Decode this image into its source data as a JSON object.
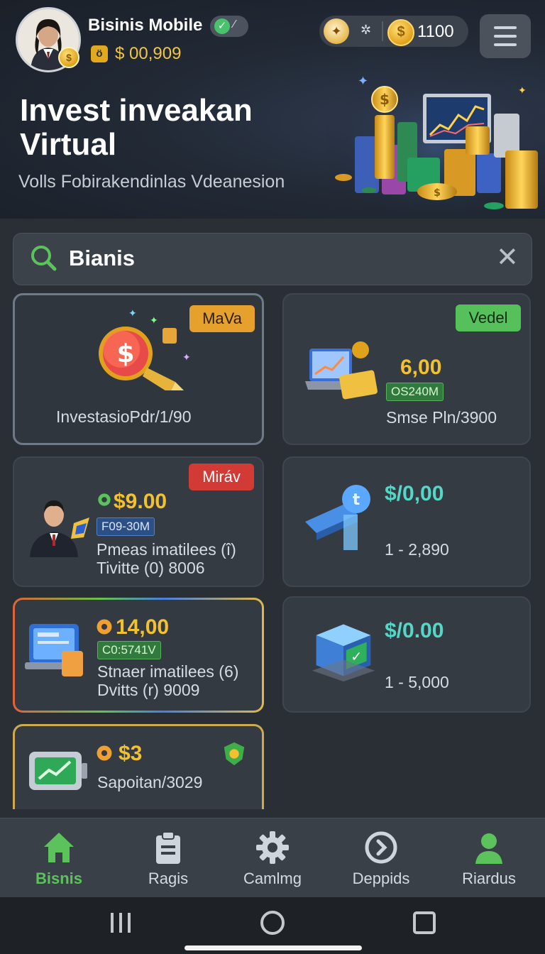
{
  "header": {
    "username": "Bisinis Mobile",
    "balance": "$ 00,909",
    "coins": "1100"
  },
  "hero": {
    "title": "Invest inveakan Virtual",
    "subtitle": "Volls Fobirakendinlas Vdeanesion"
  },
  "search": {
    "value": "Bianis"
  },
  "cards": [
    {
      "badge": "MaVa",
      "line1": "InvestasioPdr/1/90"
    },
    {
      "badge": "Vedel",
      "price": "6,00",
      "tag": "OS240M",
      "line1": "Smse Pln/3900"
    },
    {
      "badge": "Miráv",
      "price": "$9.00",
      "tag": "F09-30M",
      "line1": "Pmeas imatilees (î)",
      "line2": "Tivitte (0) 8006"
    },
    {
      "price": "$/0,00",
      "line1": "1 - 2,890"
    },
    {
      "price": "14,00",
      "tag": "C0:5741V",
      "line1": "Stnaer imatilees (6)",
      "line2": "Dvitts (r) 9009"
    },
    {
      "price": "$/0.00",
      "line1": "1 - 5,000"
    },
    {
      "price": "$3",
      "line1": "Sapoitan/3029"
    }
  ],
  "nav": [
    {
      "label": "Bisnis",
      "active": true
    },
    {
      "label": "Ragis",
      "active": false
    },
    {
      "label": "Camlmg",
      "active": false
    },
    {
      "label": "Deppids",
      "active": false
    },
    {
      "label": "Riardus",
      "active": false
    }
  ],
  "colors": {
    "accent_green": "#5cc35c",
    "gold": "#f2c12e",
    "teal": "#55d6c6"
  }
}
